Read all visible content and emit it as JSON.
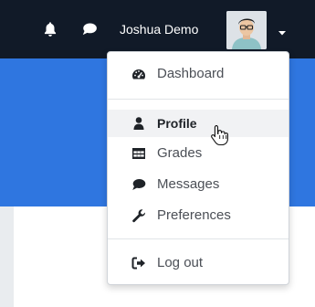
{
  "navbar": {
    "user_name": "Joshua Demo",
    "icons": {
      "notifications": "bell-icon",
      "messages": "chat-bubble-icon",
      "menu_toggle": "caret-down-icon"
    }
  },
  "user_menu": {
    "items": [
      {
        "label": "Dashboard",
        "icon": "tachometer-icon"
      },
      {
        "label": "Profile",
        "icon": "user-icon",
        "hovered": true
      },
      {
        "label": "Grades",
        "icon": "table-icon"
      },
      {
        "label": "Messages",
        "icon": "comment-icon"
      },
      {
        "label": "Preferences",
        "icon": "wrench-icon"
      },
      {
        "label": "Log out",
        "icon": "sign-out-icon"
      }
    ]
  },
  "colors": {
    "navbar_bg": "#111a28",
    "brand_blue": "#2f76e0",
    "hover_bg": "#f1f2f4"
  }
}
